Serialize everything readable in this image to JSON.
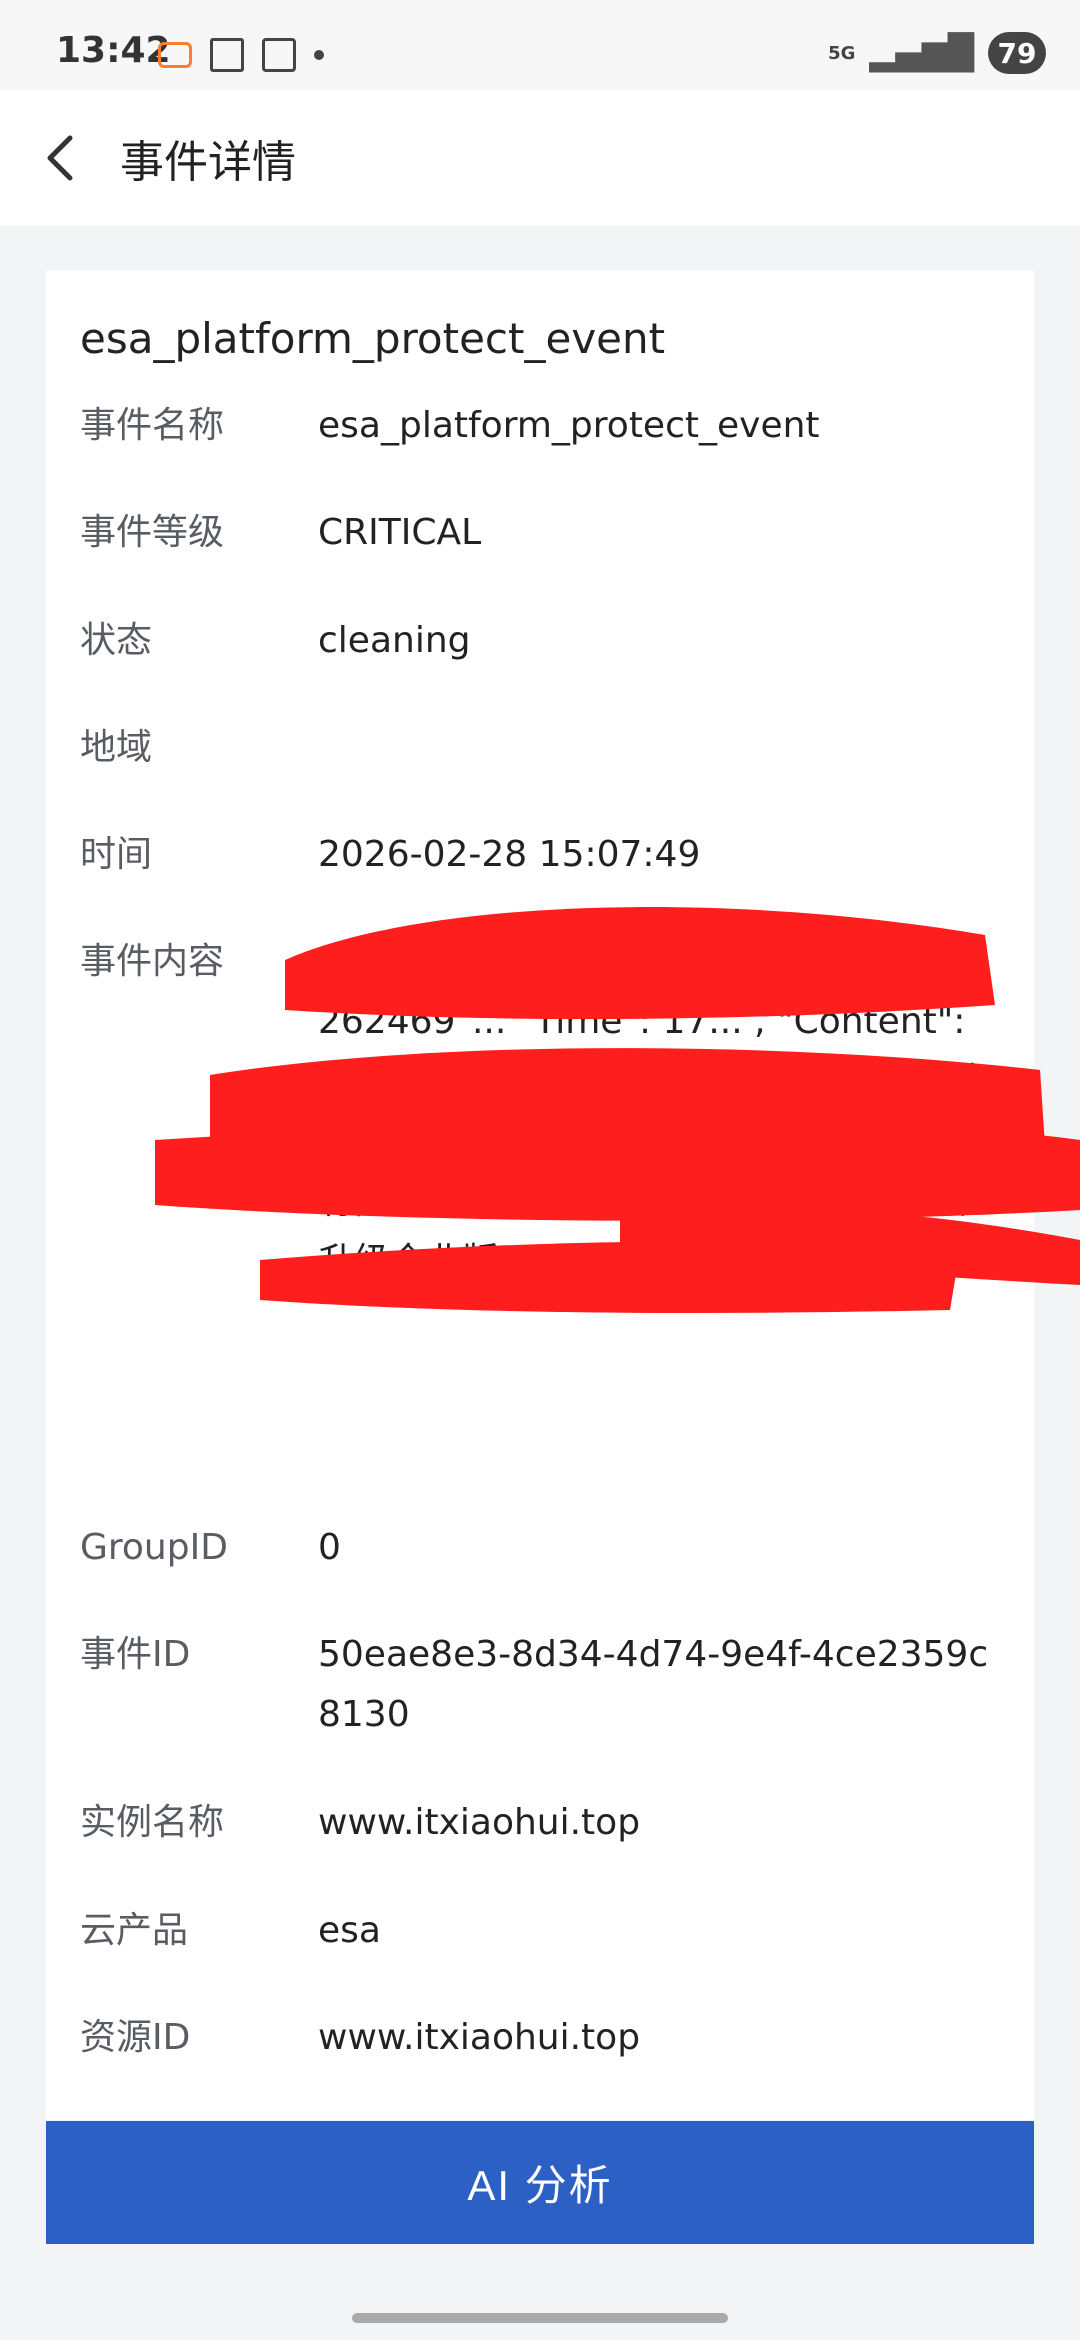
{
  "status_bar": {
    "time": "13:42",
    "battery": "79",
    "network": "5G"
  },
  "header": {
    "title": "事件详情"
  },
  "event": {
    "title": "esa_platform_protect_event",
    "fields": [
      {
        "label": "事件名称",
        "value": "esa_platform_protect_event"
      },
      {
        "label": "事件等级",
        "value": "CRITICAL"
      },
      {
        "label": "状态",
        "value": "cleaning"
      },
      {
        "label": "地域",
        "value": ""
      },
      {
        "label": "时间",
        "value": "2026-02-28 15:07:49"
      },
      {
        "label": "事件内容",
        "value": "{\"...\" \"EventId\": \"platform...ect_1772262469\"... \"Time\": 17... , \"Content\": \"您的ESA记录www.itxiaohui.top正遭受DDoS攻击，ESA DDoS基础防护正在提供有限的尽力防御。如需更高规格防护建议升级企业版。\"}"
      },
      {
        "label": "GroupID",
        "value": "0"
      },
      {
        "label": "事件ID",
        "value": "50eae8e3-8d34-4d74-9e4f-4ce2359c8130"
      },
      {
        "label": "实例名称",
        "value": "www.itxiaohui.top"
      },
      {
        "label": "云产品",
        "value": "esa"
      },
      {
        "label": "资源ID",
        "value": "www.itxiaohui.top"
      }
    ]
  },
  "footer": {
    "button_label": "AI 分析"
  },
  "colors": {
    "accent": "#2d60c5",
    "redaction": "#ff1e1e"
  }
}
